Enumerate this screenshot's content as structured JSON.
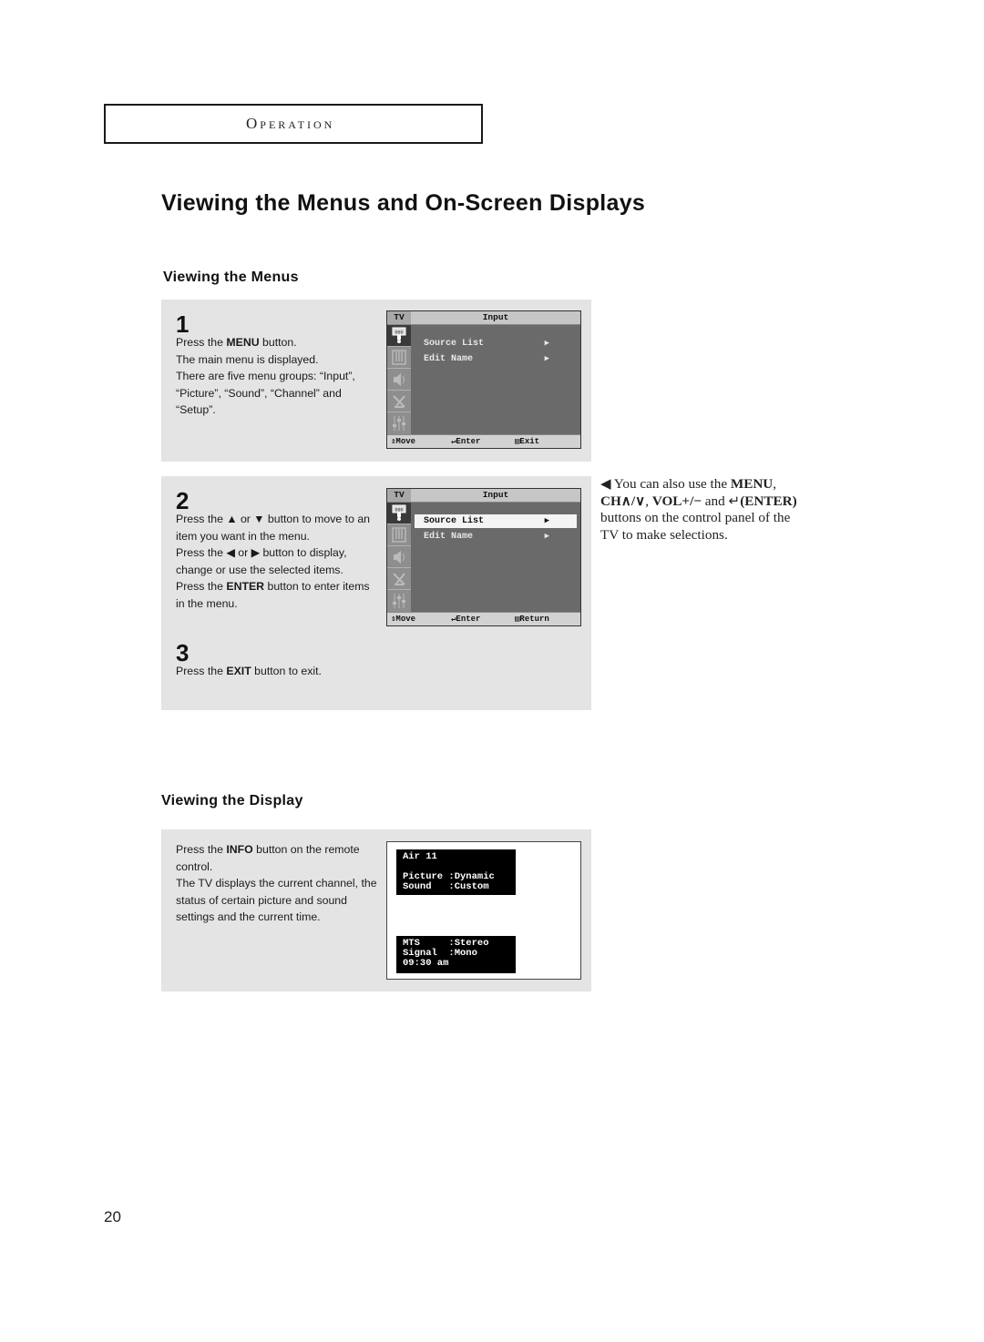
{
  "header": {
    "section": "Operation"
  },
  "title": "Viewing the Menus and On-Screen Displays",
  "menus_section": {
    "heading": "Viewing the Menus",
    "steps": [
      {
        "number": "1",
        "lines": [
          {
            "pre": "Press the ",
            "bold": "MENU",
            "post": " button."
          },
          {
            "pre": "The main menu is displayed.",
            "bold": "",
            "post": ""
          },
          {
            "pre": "There are five menu groups: “Input”, “Picture”, “Sound”, “Channel” and “Setup”.",
            "bold": "",
            "post": ""
          }
        ]
      },
      {
        "number": "2",
        "lines": [
          {
            "pre": "Press the ▲ or ▼ button to move to an item you want in the menu.",
            "bold": "",
            "post": ""
          },
          {
            "pre": "Press the ◀ or ▶ button to display, change or use the selected items.",
            "bold": "",
            "post": ""
          },
          {
            "pre": "Press the ",
            "bold": "ENTER",
            "post": " button to enter items in the menu."
          }
        ]
      },
      {
        "number": "3",
        "lines": [
          {
            "pre": "Press the ",
            "bold": "EXIT",
            "post": " button to exit."
          }
        ]
      }
    ],
    "osd_screens": [
      {
        "tv_label": "TV",
        "title": "Input",
        "icons": [
          "input-icon",
          "picture-icon",
          "sound-icon",
          "channel-icon",
          "setup-icon"
        ],
        "items": [
          {
            "label": "Source List",
            "arrow": "▶",
            "selected": false
          },
          {
            "label": "Edit Name",
            "arrow": "▶",
            "selected": false
          }
        ],
        "footer": {
          "move": "⇕Move",
          "enter": "Enter",
          "exit": "Exit"
        }
      },
      {
        "tv_label": "TV",
        "title": "Input",
        "icons": [
          "input-icon",
          "picture-icon",
          "sound-icon",
          "channel-icon",
          "setup-icon"
        ],
        "items": [
          {
            "label": "Source List",
            "arrow": "▶",
            "selected": true
          },
          {
            "label": "Edit Name",
            "arrow": "▶",
            "selected": false
          }
        ],
        "footer": {
          "move": "⇕Move",
          "enter": "Enter",
          "exit": "Return"
        }
      }
    ]
  },
  "side_note": {
    "lead": "◀ You can also use the ",
    "menu": "MENU",
    "comma1": ",",
    "ch": "CH∧/∨",
    "comma2": ", ",
    "vol": "VOL+/−",
    "and": " and ",
    "enter": "(ENTER)",
    "rest": " buttons on the control panel of the TV to make selections."
  },
  "display_section": {
    "heading": "Viewing the Display",
    "lines": [
      {
        "pre": "Press the ",
        "bold": "INFO",
        "post": " button on the remote control."
      },
      {
        "pre": "The TV displays the current channel, the status of certain picture and sound settings and the current time.",
        "bold": "",
        "post": ""
      }
    ],
    "info_top": "Air 11\n\nPicture :Dynamic\nSound   :Custom",
    "info_bottom": "MTS     :Stereo\nSignal  :Mono\n09:30 am"
  },
  "page_number": "20"
}
